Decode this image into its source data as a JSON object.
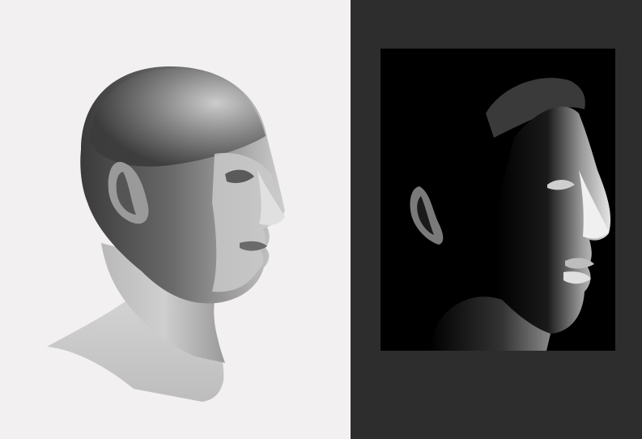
{
  "colors": {
    "left_background": "#f2f0f1",
    "right_background": "#2d2d2d",
    "photo_background": "#000000",
    "render_highlight": "#d9d9d9",
    "render_mid": "#8c8c8c",
    "render_shadow": "#3f3f3f",
    "photo_highlight": "#e8e8e8"
  },
  "panels": {
    "left": {
      "content": "3d-shaded-head-render",
      "view": "profile-facing-right"
    },
    "right": {
      "content": "black-and-white-portrait-photo",
      "view": "profile-facing-right"
    }
  }
}
